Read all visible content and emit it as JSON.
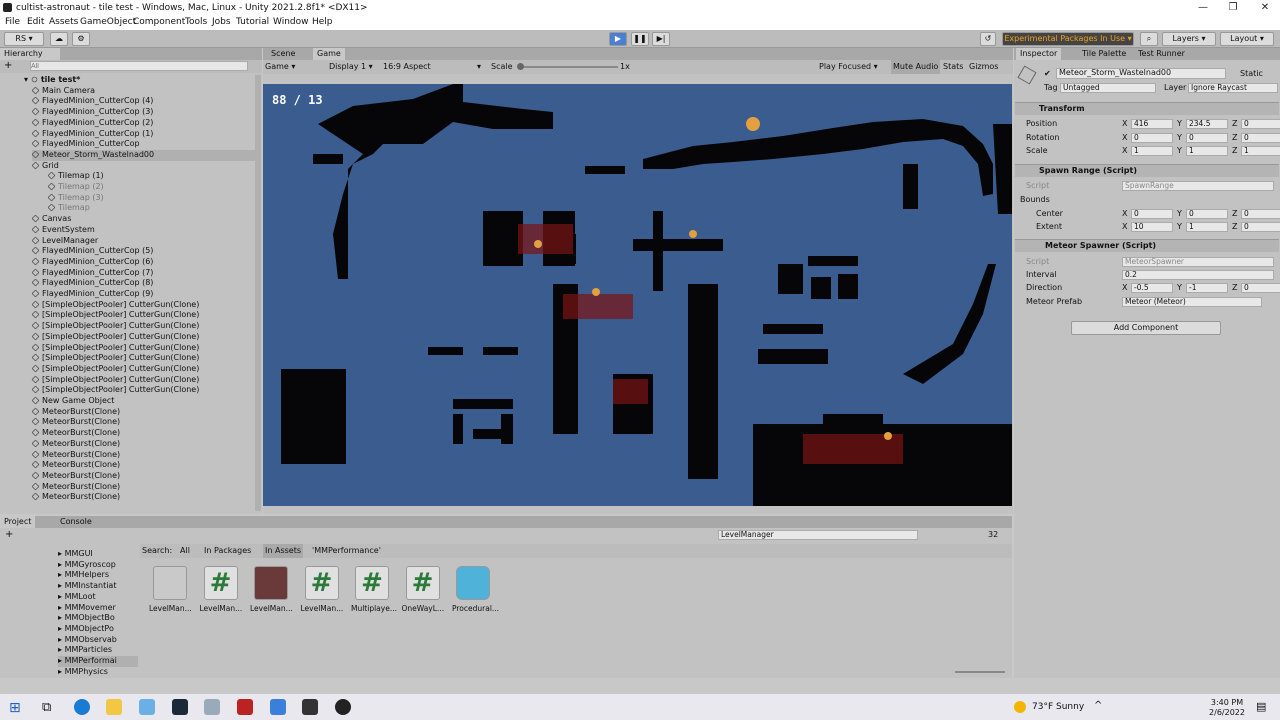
{
  "window": {
    "title": "cultist-astronaut - tile test - Windows, Mac, Linux - Unity 2021.2.8f1* <DX11>"
  },
  "menu": [
    "File",
    "Edit",
    "Assets",
    "GameObject",
    "Component",
    "Tools",
    "Jobs",
    "Tutorial",
    "Window",
    "Help"
  ],
  "toolbar": {
    "account": "RS",
    "experimental": "Experimental Packages In Use",
    "layers": "Layers",
    "layout": "Layout"
  },
  "hierarchy": {
    "tab": "Hierarchy",
    "search_placeholder": "All",
    "scene": "tile test*",
    "items": [
      {
        "label": "Main Camera",
        "indent": 2,
        "dim": false
      },
      {
        "label": "FlayedMinion_CutterCop (4)",
        "indent": 2,
        "dim": false
      },
      {
        "label": "FlayedMinion_CutterCop (3)",
        "indent": 2,
        "dim": false
      },
      {
        "label": "FlayedMinion_CutterCop (2)",
        "indent": 2,
        "dim": false
      },
      {
        "label": "FlayedMinion_CutterCop (1)",
        "indent": 2,
        "dim": false
      },
      {
        "label": "FlayedMinion_CutterCop",
        "indent": 2,
        "dim": false
      },
      {
        "label": "Meteor_Storm_Wastelnad00",
        "indent": 2,
        "dim": false,
        "sel": true
      },
      {
        "label": "Grid",
        "indent": 2,
        "dim": false
      },
      {
        "label": "Tilemap (1)",
        "indent": 3,
        "dim": false
      },
      {
        "label": "Tilemap (2)",
        "indent": 3,
        "dim": true
      },
      {
        "label": "Tilemap (3)",
        "indent": 3,
        "dim": true
      },
      {
        "label": "Tilemap",
        "indent": 3,
        "dim": true
      },
      {
        "label": "Canvas",
        "indent": 2,
        "dim": false
      },
      {
        "label": "EventSystem",
        "indent": 2,
        "dim": false
      },
      {
        "label": "LevelManager",
        "indent": 2,
        "dim": false
      },
      {
        "label": "FlayedMinion_CutterCop (5)",
        "indent": 2,
        "dim": false
      },
      {
        "label": "FlayedMinion_CutterCop (6)",
        "indent": 2,
        "dim": false
      },
      {
        "label": "FlayedMinion_CutterCop (7)",
        "indent": 2,
        "dim": false
      },
      {
        "label": "FlayedMinion_CutterCop (8)",
        "indent": 2,
        "dim": false
      },
      {
        "label": "FlayedMinion_CutterCop (9)",
        "indent": 2,
        "dim": false
      },
      {
        "label": "[SimpleObjectPooler] CutterGun(Clone)",
        "indent": 2,
        "dim": false
      },
      {
        "label": "[SimpleObjectPooler] CutterGun(Clone)",
        "indent": 2,
        "dim": false
      },
      {
        "label": "[SimpleObjectPooler] CutterGun(Clone)",
        "indent": 2,
        "dim": false
      },
      {
        "label": "[SimpleObjectPooler] CutterGun(Clone)",
        "indent": 2,
        "dim": false
      },
      {
        "label": "[SimpleObjectPooler] CutterGun(Clone)",
        "indent": 2,
        "dim": false
      },
      {
        "label": "[SimpleObjectPooler] CutterGun(Clone)",
        "indent": 2,
        "dim": false
      },
      {
        "label": "[SimpleObjectPooler] CutterGun(Clone)",
        "indent": 2,
        "dim": false
      },
      {
        "label": "[SimpleObjectPooler] CutterGun(Clone)",
        "indent": 2,
        "dim": false
      },
      {
        "label": "[SimpleObjectPooler] CutterGun(Clone)",
        "indent": 2,
        "dim": false
      },
      {
        "label": "New Game Object",
        "indent": 2,
        "dim": false
      },
      {
        "label": "MeteorBurst(Clone)",
        "indent": 2,
        "dim": false
      },
      {
        "label": "MeteorBurst(Clone)",
        "indent": 2,
        "dim": false
      },
      {
        "label": "MeteorBurst(Clone)",
        "indent": 2,
        "dim": false
      },
      {
        "label": "MeteorBurst(Clone)",
        "indent": 2,
        "dim": false
      },
      {
        "label": "MeteorBurst(Clone)",
        "indent": 2,
        "dim": false
      },
      {
        "label": "MeteorBurst(Clone)",
        "indent": 2,
        "dim": false
      },
      {
        "label": "MeteorBurst(Clone)",
        "indent": 2,
        "dim": false
      },
      {
        "label": "MeteorBurst(Clone)",
        "indent": 2,
        "dim": false
      },
      {
        "label": "MeteorBurst(Clone)",
        "indent": 2,
        "dim": false
      }
    ]
  },
  "game": {
    "tabs": [
      "Scene",
      "Game"
    ],
    "mode": "Game",
    "display": "Display 1",
    "aspect": "16:9 Aspect",
    "scale_label": "Scale",
    "scale_value": "1x",
    "play_focused": "Play Focused",
    "mute": "Mute Audio",
    "stats": "Stats",
    "gizmos": "Gizmos",
    "hud": "88 / 13",
    "bg": "#3b5c8e"
  },
  "inspector": {
    "tabs": [
      "Inspector",
      "Tile Palette",
      "Test Runner"
    ],
    "object_name": "Meteor_Storm_Wastelnad00",
    "static": "Static",
    "tag_label": "Tag",
    "tag": "Untagged",
    "layer_label": "Layer",
    "layer": "Ignore Raycast",
    "transform": {
      "title": "Transform",
      "position": [
        "416",
        "234.5",
        "0"
      ],
      "rotation": [
        "0",
        "0",
        "0"
      ],
      "scale": [
        "1",
        "1",
        "1"
      ],
      "labels": [
        "Position",
        "Rotation",
        "Scale"
      ]
    },
    "spawn_range": {
      "title": "Spawn Range (Script)",
      "script_label": "Script",
      "script": "SpawnRange",
      "bounds": "Bounds",
      "center_label": "Center",
      "center": [
        "0",
        "0",
        "0"
      ],
      "extent_label": "Extent",
      "extent": [
        "10",
        "1",
        "0"
      ]
    },
    "meteor_spawner": {
      "title": "Meteor Spawner (Script)",
      "script_label": "Script",
      "script": "MeteorSpawner",
      "interval_label": "Interval",
      "interval": "0.2",
      "direction_label": "Direction",
      "direction": [
        "-0.5",
        "-1",
        "0"
      ],
      "prefab_label": "Meteor Prefab",
      "prefab": "Meteor (Meteor)"
    },
    "add_component": "Add Component",
    "axis": [
      "X",
      "Y",
      "Z"
    ]
  },
  "project": {
    "tabs": [
      "Project",
      "Console"
    ],
    "search_label": "Search:",
    "filters": [
      "All",
      "In Packages",
      "In Assets",
      "'MMPerformance'"
    ],
    "search_value": "LevelManager",
    "count": "32",
    "folders": [
      "MMGUI",
      "MMGyroscop",
      "MMHelpers",
      "MMInstantiat",
      "MMLoot",
      "MMMovemer",
      "MMObjectBo",
      "MMObjectPo",
      "MMObservab",
      "MMParticles",
      "MMPerformai",
      "MMPhysics"
    ],
    "assets": [
      {
        "label": "LevelMan...",
        "type": "folder"
      },
      {
        "label": "LevelMan...",
        "type": "script"
      },
      {
        "label": "LevelMan...",
        "type": "prefab"
      },
      {
        "label": "LevelMan...",
        "type": "script"
      },
      {
        "label": "Multiplaye...",
        "type": "script"
      },
      {
        "label": "OneWayL...",
        "type": "script"
      },
      {
        "label": "Procedural...",
        "type": "cube"
      }
    ]
  },
  "taskbar": {
    "weather": "73°F Sunny",
    "time": "3:40 PM",
    "date": "2/6/2022"
  }
}
